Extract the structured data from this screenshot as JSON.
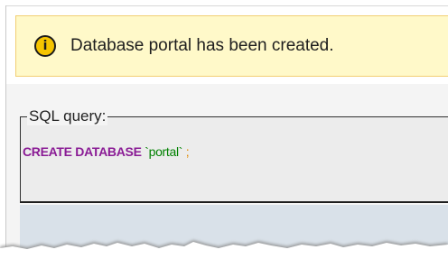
{
  "notice": {
    "icon": "info-icon",
    "icon_glyph": "i",
    "message": "Database portal has been created."
  },
  "sql_panel": {
    "legend": "SQL query:",
    "keyword": "CREATE DATABASE",
    "db_name": "`portal`",
    "terminator": ";"
  },
  "colors": {
    "notice_bg": "#fff9c9",
    "notice_border": "#f2cf74",
    "keyword": "#8a1b95",
    "string": "#008000",
    "bottom_area": "#d9e1e9"
  }
}
